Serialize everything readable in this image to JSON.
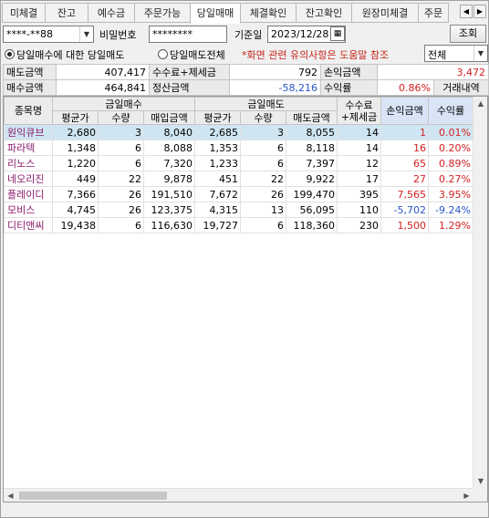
{
  "tabs": [
    "미체결",
    "잔고",
    "예수금",
    "주문가능",
    "당일매매",
    "체결확인",
    "잔고확인",
    "원장미체결",
    "주문"
  ],
  "active_tab_index": 4,
  "tab_nav": {
    "left": "◀",
    "right": "▶"
  },
  "account": {
    "value": "****-**88",
    "dropdown_icon": "▼"
  },
  "password": {
    "label": "비밀번호",
    "value": "********"
  },
  "base_date": {
    "label": "기준일",
    "value": "2023/12/28",
    "calendar_icon": "▦"
  },
  "search_button": "조회",
  "radio_options": [
    {
      "label": "당일매수에 대한 당일매도",
      "checked": true
    },
    {
      "label": "당일매도전체",
      "checked": false
    }
  ],
  "notice": "*화면 관련 유의사항은 도움말 참조",
  "filter": {
    "value": "전체",
    "dropdown_icon": "▼"
  },
  "summary": {
    "row1": {
      "sell_amount_label": "매도금액",
      "sell_amount": "407,417",
      "fee_tax_label": "수수료+제세금",
      "fee_tax": "792",
      "pl_label": "손익금액",
      "pl": "3,472"
    },
    "row2": {
      "buy_amount_label": "매수금액",
      "buy_amount": "464,841",
      "settle_label": "정산금액",
      "settle": "-58,216",
      "return_label": "수익률",
      "return": "0.86%",
      "history_label": "거래내역"
    }
  },
  "grid": {
    "group_headers": {
      "name": "종목명",
      "buy": "금일매수",
      "sell": "금일매도",
      "fee": "수수료\n+제세금",
      "pl": "손익금액",
      "rate": "수익률"
    },
    "sub_headers": {
      "buy_avg": "평균가",
      "buy_qty": "수량",
      "buy_amt": "매입금액",
      "sell_avg": "평균가",
      "sell_qty": "수량",
      "sell_amt": "매도금액"
    },
    "rows": [
      {
        "name": "원익큐브",
        "buy_avg": "2,680",
        "buy_qty": "3",
        "buy_amt": "8,040",
        "sell_avg": "2,685",
        "sell_qty": "3",
        "sell_amt": "8,055",
        "fee": "14",
        "pl": "1",
        "rate": "0.01%",
        "negative": false,
        "selected": true
      },
      {
        "name": "파라텍",
        "buy_avg": "1,348",
        "buy_qty": "6",
        "buy_amt": "8,088",
        "sell_avg": "1,353",
        "sell_qty": "6",
        "sell_amt": "8,118",
        "fee": "14",
        "pl": "16",
        "rate": "0.20%",
        "negative": false,
        "selected": false
      },
      {
        "name": "리노스",
        "buy_avg": "1,220",
        "buy_qty": "6",
        "buy_amt": "7,320",
        "sell_avg": "1,233",
        "sell_qty": "6",
        "sell_amt": "7,397",
        "fee": "12",
        "pl": "65",
        "rate": "0.89%",
        "negative": false,
        "selected": false
      },
      {
        "name": "네오리진",
        "buy_avg": "449",
        "buy_qty": "22",
        "buy_amt": "9,878",
        "sell_avg": "451",
        "sell_qty": "22",
        "sell_amt": "9,922",
        "fee": "17",
        "pl": "27",
        "rate": "0.27%",
        "negative": false,
        "selected": false
      },
      {
        "name": "플레이디",
        "buy_avg": "7,366",
        "buy_qty": "26",
        "buy_amt": "191,510",
        "sell_avg": "7,672",
        "sell_qty": "26",
        "sell_amt": "199,470",
        "fee": "395",
        "pl": "7,565",
        "rate": "3.95%",
        "negative": false,
        "selected": false
      },
      {
        "name": "모비스",
        "buy_avg": "4,745",
        "buy_qty": "26",
        "buy_amt": "123,375",
        "sell_avg": "4,315",
        "sell_qty": "13",
        "sell_amt": "56,095",
        "fee": "110",
        "pl": "-5,702",
        "rate": "-9.24%",
        "negative": true,
        "selected": false
      },
      {
        "name": "디티앤씨",
        "buy_avg": "19,438",
        "buy_qty": "6",
        "buy_amt": "116,630",
        "sell_avg": "19,727",
        "sell_qty": "6",
        "sell_amt": "118,360",
        "fee": "230",
        "pl": "1,500",
        "rate": "1.29%",
        "negative": false,
        "selected": false
      }
    ]
  },
  "scroll": {
    "up": "▲",
    "down": "▼",
    "left": "◀",
    "right": "▶"
  },
  "colors": {
    "positive": "#d42020",
    "negative": "#2a55c8",
    "stock_name": "#8a1a6a",
    "selected_row": "#cfe6f2",
    "header_highlight": "#d9e4f7"
  }
}
